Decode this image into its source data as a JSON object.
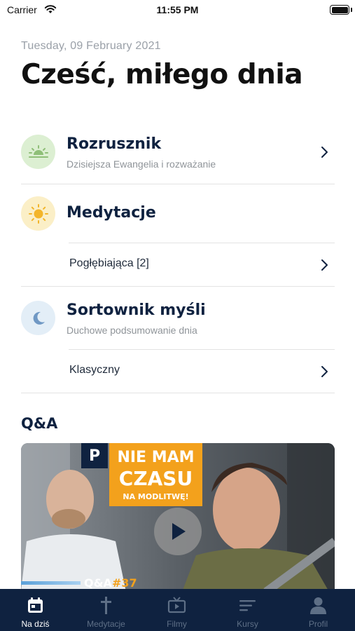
{
  "status_bar": {
    "carrier": "Carrier",
    "time": "11:55 PM"
  },
  "header": {
    "date": "Tuesday, 09 February 2021",
    "greeting": "Cześć, miłego dnia"
  },
  "sections": [
    {
      "title": "Rozrusznik",
      "subtitle": "Dzisiejsza Ewangelia i rozważanie",
      "icon": "sunrise-icon"
    },
    {
      "title": "Medytacje",
      "icon": "sun-icon",
      "items": [
        {
          "label": "Pogłębiająca [2]"
        }
      ]
    },
    {
      "title": "Sortownik myśli",
      "subtitle": "Duchowe podsumowanie dnia",
      "icon": "moon-icon",
      "items": [
        {
          "label": "Klasyczny"
        }
      ]
    }
  ],
  "qa": {
    "title": "Q&A",
    "video": {
      "banner_line1": "NIE MAM",
      "banner_line2": "CZASU",
      "banner_line3": "NA  MODLITWĘ!",
      "logo": "P",
      "caption": "Q&A",
      "caption_number": "#37"
    }
  },
  "tab_bar": {
    "tabs": [
      {
        "label": "Na dziś",
        "icon": "calendar-icon",
        "active": true
      },
      {
        "label": "Medytacje",
        "icon": "cross-icon",
        "active": false
      },
      {
        "label": "Filmy",
        "icon": "tv-icon",
        "active": false
      },
      {
        "label": "Kursy",
        "icon": "list-icon",
        "active": false
      },
      {
        "label": "Profil",
        "icon": "person-icon",
        "active": false
      }
    ]
  },
  "colors": {
    "navy": "#0f2240",
    "accent_orange": "#f3a11c",
    "green_circle": "#dcefd2",
    "yellow_circle": "#fbefc7",
    "blue_circle": "#e3eef7"
  }
}
